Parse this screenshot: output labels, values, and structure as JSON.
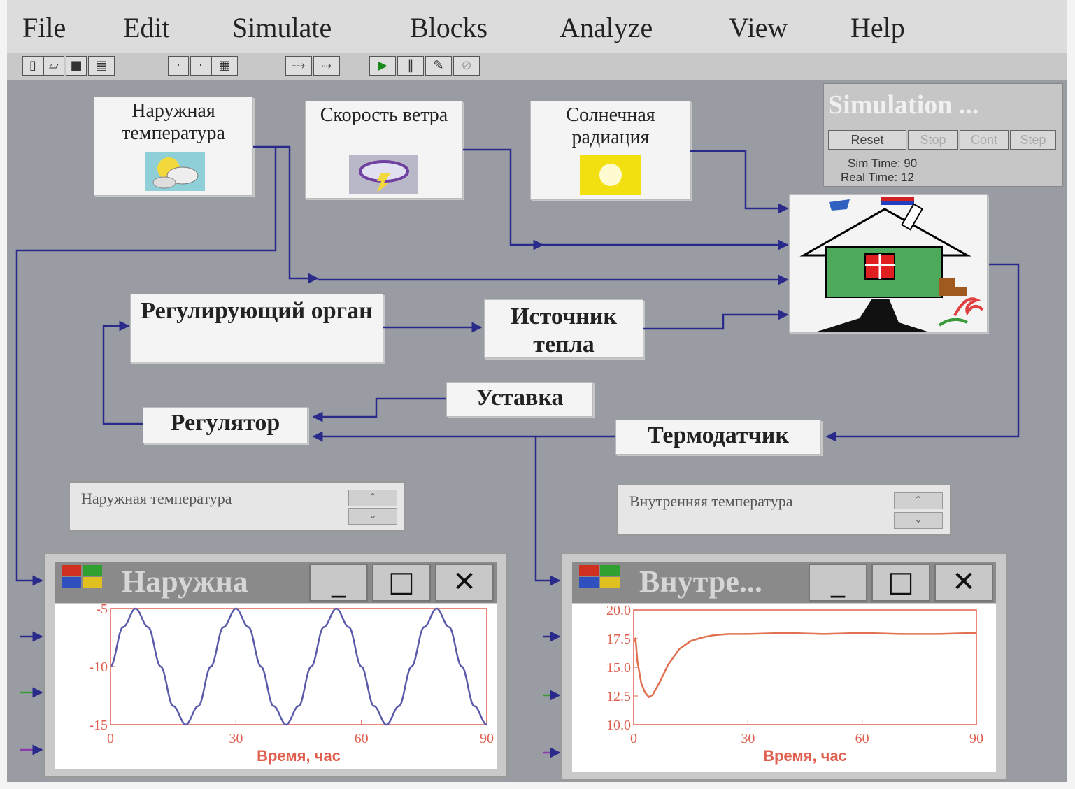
{
  "menu": [
    "File",
    "Edit",
    "Simulate",
    "Blocks",
    "Analyze",
    "View",
    "Help"
  ],
  "blocks": {
    "outside_temp": "Наружная температура",
    "wind_speed": "Скорость ветра",
    "solar_radiation": "Солнечная радиация",
    "actuator": "Регулирующий орган",
    "heat_source": "Источник тепла",
    "setpoint": "Уставка",
    "regulator": "Регулятор",
    "thermosensor": "Термодатчик"
  },
  "icons": {
    "outside_temp": "partly-cloudy-icon",
    "wind_speed": "storm-cloud-icon",
    "solar_radiation": "sun-icon",
    "house": "house-icon"
  },
  "simulation": {
    "title": "Simulation ...",
    "buttons": [
      "Reset",
      "Stop",
      "Cont",
      "Step"
    ],
    "sim_time_label": "Sim Time: 90",
    "real_time_label": "Real Time: 12"
  },
  "selectors": {
    "left": "Наружная температура",
    "right": "Внутренняя температура"
  },
  "plots": {
    "left_title": "Наружна",
    "right_title": "Внутре...",
    "minimize": "_",
    "maximize": "□",
    "close": "✕"
  },
  "chart_data": [
    {
      "type": "line",
      "title": "",
      "xlabel": "Время, час",
      "ylabel": "",
      "xlim": [
        0,
        90
      ],
      "ylim": [
        -15,
        -5
      ],
      "xticks": [
        "0",
        "30",
        "60",
        "90"
      ],
      "yticks": [
        "-5",
        "-10",
        "-15"
      ],
      "series": [
        {
          "x": [
            0,
            3,
            6,
            9,
            12,
            15,
            18,
            21,
            24,
            27,
            30,
            33,
            36,
            39,
            42,
            45,
            48,
            51,
            54,
            57,
            60,
            63,
            66,
            69,
            72,
            75,
            78,
            81,
            84,
            87,
            90
          ],
          "values": [
            -10,
            -6.6,
            -5,
            -6.6,
            -10,
            -13.4,
            -15,
            -13.4,
            -10,
            -6.6,
            -5,
            -6.6,
            -10,
            -13.4,
            -15,
            -13.4,
            -10,
            -6.6,
            -5,
            -6.6,
            -10,
            -13.4,
            -15,
            -13.4,
            -10,
            -6.6,
            -5,
            -6.6,
            -10,
            -13.4,
            -15
          ]
        }
      ]
    },
    {
      "type": "line",
      "title": "",
      "xlabel": "Время, час",
      "ylabel": "",
      "xlim": [
        0,
        90
      ],
      "ylim": [
        10,
        20
      ],
      "xticks": [
        "0",
        "30",
        "60",
        "90"
      ],
      "yticks": [
        "20.0",
        "17.5",
        "15.0",
        "12.5",
        "10.0"
      ],
      "series": [
        {
          "x": [
            0,
            0.5,
            1,
            2,
            3,
            4,
            5,
            7,
            9,
            12,
            15,
            18,
            21,
            25,
            30,
            40,
            50,
            60,
            70,
            80,
            90
          ],
          "values": [
            17.2,
            17.5,
            15.5,
            13.6,
            12.8,
            12.4,
            12.6,
            13.8,
            15.2,
            16.6,
            17.3,
            17.6,
            17.8,
            17.9,
            17.9,
            18.0,
            17.9,
            18.0,
            17.9,
            17.9,
            18.0
          ]
        }
      ]
    }
  ],
  "colors": {
    "wire": "#2a2a8a",
    "sine": "#5a5aaa",
    "inside_curve": "#e07050",
    "axis": "#e06050",
    "background": "#9a9ca4"
  }
}
